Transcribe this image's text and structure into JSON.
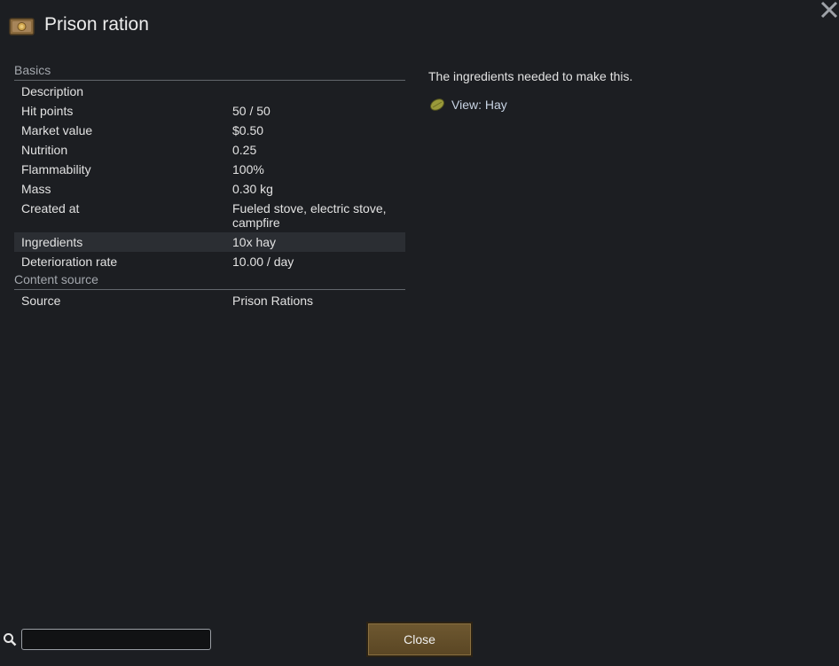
{
  "window": {
    "title": "Prison ration",
    "title_icon": "meal-icon",
    "close_icon": "close-icon"
  },
  "stats": {
    "basics_header": "Basics",
    "rows": [
      {
        "label": "Description",
        "value": ""
      },
      {
        "label": "Hit points",
        "value": "50 / 50"
      },
      {
        "label": "Market value",
        "value": "$0.50"
      },
      {
        "label": "Nutrition",
        "value": "0.25"
      },
      {
        "label": "Flammability",
        "value": "100%"
      },
      {
        "label": "Mass",
        "value": "0.30 kg"
      },
      {
        "label": "Created at",
        "value": "Fueled stove, electric stove, campfire"
      },
      {
        "label": "Ingredients",
        "value": "10x hay"
      },
      {
        "label": "Deterioration rate",
        "value": "10.00 / day"
      }
    ],
    "content_source_header": "Content source",
    "source_row": {
      "label": "Source",
      "value": "Prison Rations"
    }
  },
  "details": {
    "description": "The ingredients needed to make this.",
    "link_label": "View: Hay",
    "link_icon": "hay-icon"
  },
  "footer": {
    "search_icon": "search-icon",
    "search_value": "",
    "search_placeholder": "",
    "close_label": "Close"
  },
  "colors": {
    "background": "#1c1e22",
    "highlight_row": "#2b2e33",
    "button": "#6e5830",
    "link": "#c8d4e4"
  }
}
